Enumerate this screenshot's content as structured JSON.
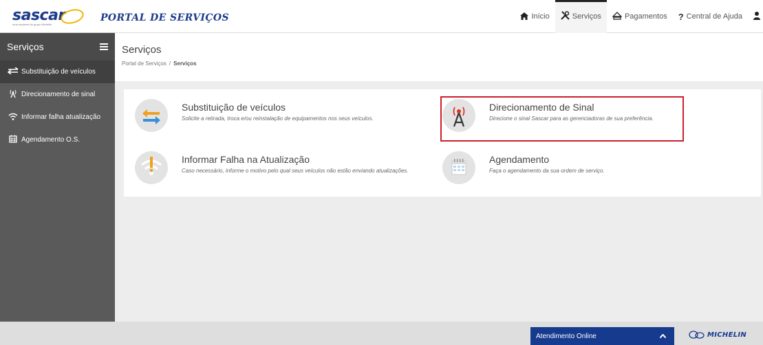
{
  "brand": {
    "logo_text": "sascar",
    "logo_tagline": "uma empresa do grupo Michelin",
    "portal_title": "PORTAL DE SERVIÇOS",
    "primary_color": "#1d3a8a",
    "accent_color": "#f0b400"
  },
  "topnav": [
    {
      "label": "Início",
      "icon": "home-icon"
    },
    {
      "label": "Serviços",
      "icon": "tools-icon",
      "active": true
    },
    {
      "label": "Pagamentos",
      "icon": "piggy-bank-icon"
    },
    {
      "label": "Central de Ajuda",
      "icon": "question-icon"
    }
  ],
  "sidebar": {
    "title": "Serviços",
    "items": [
      {
        "label": "Substituição de veículos",
        "icon": "swap-arrows-icon",
        "active": true
      },
      {
        "label": "Direcionamento de sinal",
        "icon": "signal-tower-icon"
      },
      {
        "label": "Informar falha atualização",
        "icon": "wifi-icon"
      },
      {
        "label": "Agendamento O.S.",
        "icon": "calendar-icon"
      }
    ]
  },
  "page": {
    "title": "Serviços",
    "breadcrumb": [
      "Portal de Serviços",
      "Serviços"
    ],
    "breadcrumb_sep": "/"
  },
  "cards": [
    {
      "title": "Substituição de veículos",
      "description": "Solicite a retirada, troca e/ou reinstalação de equipamentos nos seus veículos.",
      "icon": "swap-arrows-icon"
    },
    {
      "title": "Direcionamento de Sinal",
      "description": "Direcione o sinal Sascar para as gerenciadoras de sua preferência.",
      "icon": "signal-tower-icon",
      "highlighted": true
    },
    {
      "title": "Informar Falha na Atualização",
      "description": "Caso necessário, informe o motivo pelo qual seus veículos não estão enviando atualizações.",
      "icon": "wifi-icon"
    },
    {
      "title": "Agendamento",
      "description": "Faça o agendamento da sua ordem de serviço.",
      "icon": "calendar-icon"
    }
  ],
  "footer": {
    "chat_label": "Atendimento Online",
    "michelin_text": "MICHELIN",
    "chat_color": "#163a8e",
    "highlight_color": "#cc1e2b"
  }
}
